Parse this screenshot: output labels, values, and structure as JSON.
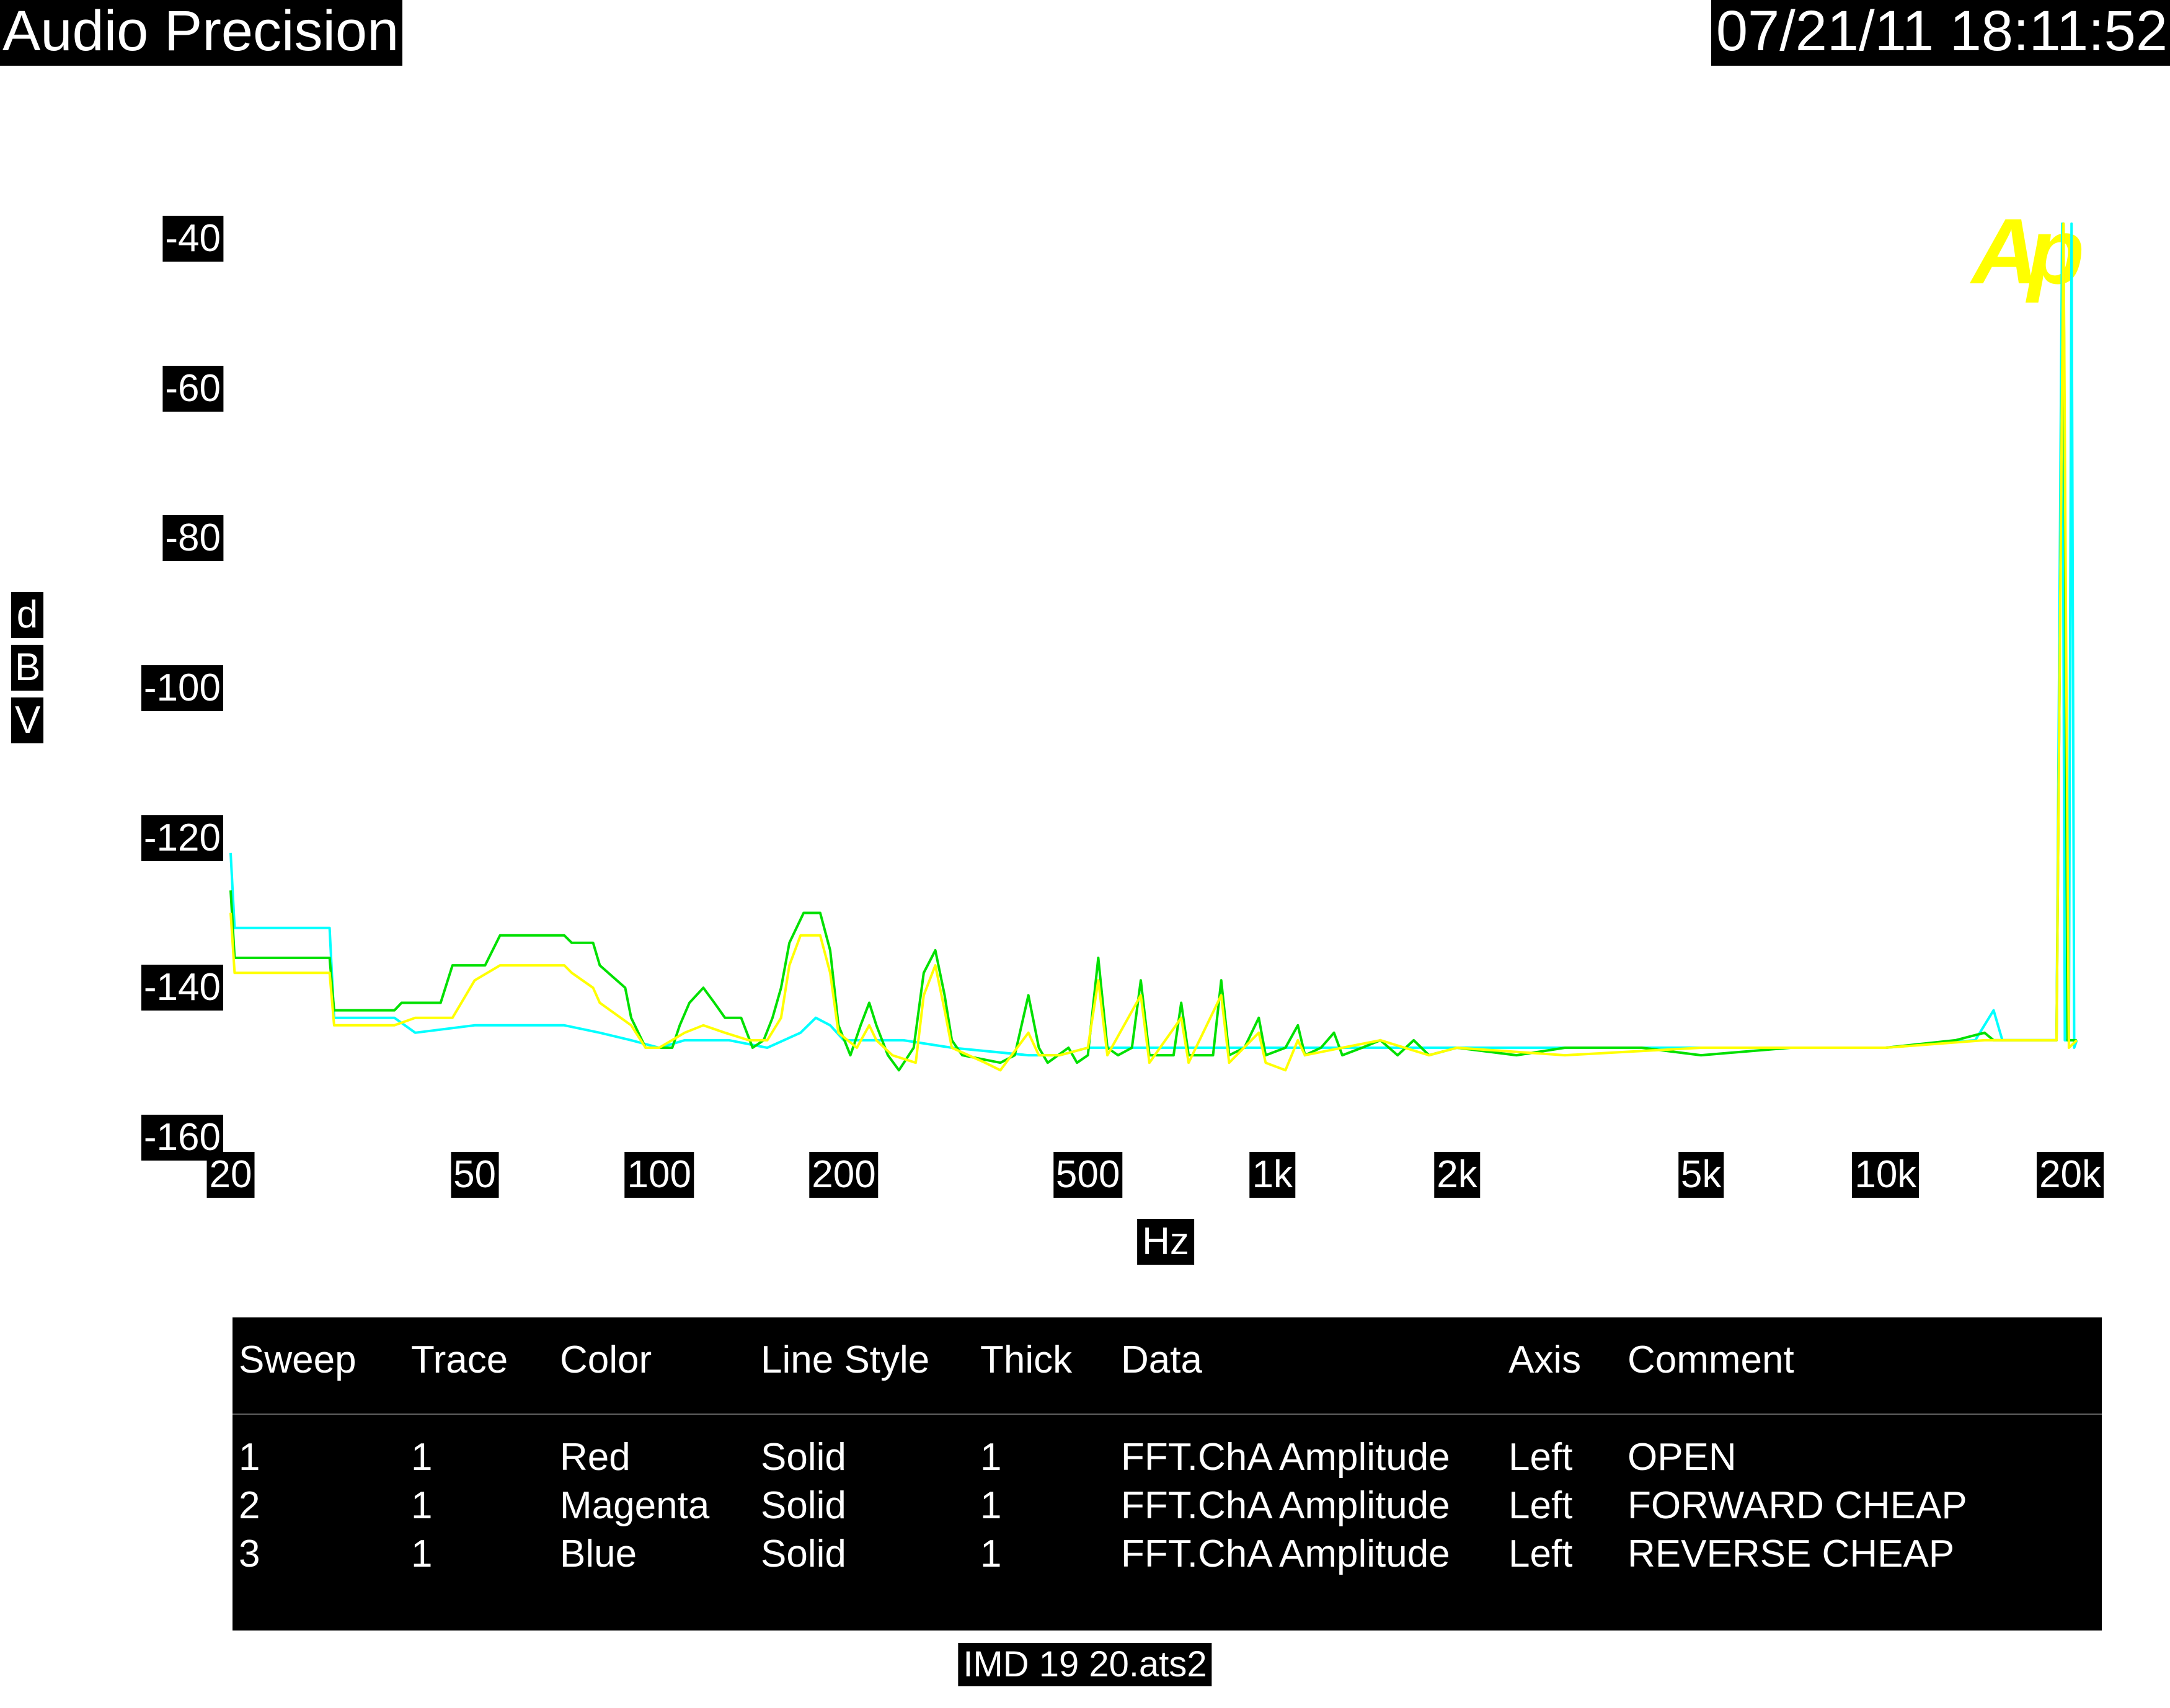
{
  "header": {
    "app_title": "Audio Precision",
    "timestamp": "07/21/11 18:11:52"
  },
  "logo_text": "Ap",
  "footer": {
    "file_name": "IMD 19 20.ats2"
  },
  "colors": {
    "background": "#ffffff",
    "label_bg": "#000000",
    "trace_open": "#00ffff",
    "trace_forward": "#00e000",
    "trace_reverse": "#ffff00",
    "logo": "#ffff00"
  },
  "legend": {
    "headers": [
      "Sweep",
      "Trace",
      "Color",
      "Line Style",
      "Thick",
      "Data",
      "Axis",
      "Comment"
    ],
    "rows": [
      [
        "1",
        "1",
        "Red",
        "Solid",
        "1",
        "FFT.ChA Amplitude",
        "Left",
        "OPEN"
      ],
      [
        "2",
        "1",
        "Magenta",
        "Solid",
        "1",
        "FFT.ChA Amplitude",
        "Left",
        "FORWARD CHEAP"
      ],
      [
        "3",
        "1",
        "Blue",
        "Solid",
        "1",
        "FFT.ChA Amplitude",
        "Left",
        "REVERSE CHEAP"
      ]
    ]
  },
  "chart_data": {
    "type": "line",
    "title": "",
    "xlabel": "Hz",
    "ylabel": "dBV",
    "ylabel_chars": [
      "d",
      "B",
      "V"
    ],
    "x_scale": "log",
    "xlim": [
      20,
      22000
    ],
    "ylim": [
      -160,
      -40
    ],
    "x_ticks": [
      {
        "value": 20,
        "label": "20"
      },
      {
        "value": 50,
        "label": "50"
      },
      {
        "value": 100,
        "label": "100"
      },
      {
        "value": 200,
        "label": "200"
      },
      {
        "value": 500,
        "label": "500"
      },
      {
        "value": 1000,
        "label": "1k"
      },
      {
        "value": 2000,
        "label": "2k"
      },
      {
        "value": 5000,
        "label": "5k"
      },
      {
        "value": 10000,
        "label": "10k"
      },
      {
        "value": 20000,
        "label": "20k"
      }
    ],
    "y_ticks": [
      {
        "value": -40,
        "label": "-40"
      },
      {
        "value": -60,
        "label": "-60"
      },
      {
        "value": -80,
        "label": "-80"
      },
      {
        "value": -100,
        "label": "-100"
      },
      {
        "value": -120,
        "label": "-120"
      },
      {
        "value": -140,
        "label": "-140"
      },
      {
        "value": -160,
        "label": "-160"
      }
    ],
    "grid": false,
    "legend_position": "bottom table",
    "series": [
      {
        "color": "#00ffff",
        "points": [
          [
            20,
            -122
          ],
          [
            20.3,
            -132
          ],
          [
            29,
            -132
          ],
          [
            29.5,
            -144
          ],
          [
            37,
            -144
          ],
          [
            40,
            -146
          ],
          [
            50,
            -145
          ],
          [
            60,
            -145
          ],
          [
            70,
            -145
          ],
          [
            80,
            -146
          ],
          [
            90,
            -147
          ],
          [
            100,
            -148
          ],
          [
            110,
            -147
          ],
          [
            130,
            -147
          ],
          [
            150,
            -148
          ],
          [
            170,
            -146
          ],
          [
            180,
            -144
          ],
          [
            190,
            -145
          ],
          [
            200,
            -147
          ],
          [
            250,
            -147
          ],
          [
            300,
            -148
          ],
          [
            400,
            -149
          ],
          [
            450,
            -149
          ],
          [
            500,
            -148
          ],
          [
            700,
            -148
          ],
          [
            1000,
            -148
          ],
          [
            1500,
            -148
          ],
          [
            2000,
            -148
          ],
          [
            3000,
            -148
          ],
          [
            4000,
            -148
          ],
          [
            5000,
            -148
          ],
          [
            7000,
            -148
          ],
          [
            10000,
            -148
          ],
          [
            14000,
            -147
          ],
          [
            15000,
            -143
          ],
          [
            15500,
            -147
          ],
          [
            17000,
            -147
          ],
          [
            19000,
            -147
          ],
          [
            19400,
            -38
          ],
          [
            19600,
            -147
          ],
          [
            19900,
            -147
          ],
          [
            20100,
            -38
          ],
          [
            20300,
            -148
          ],
          [
            20500,
            -147
          ]
        ]
      },
      {
        "color": "#00e000",
        "points": [
          [
            20,
            -127
          ],
          [
            20.3,
            -136
          ],
          [
            29,
            -136
          ],
          [
            29.5,
            -143
          ],
          [
            37,
            -143
          ],
          [
            38,
            -142
          ],
          [
            44,
            -142
          ],
          [
            46,
            -137
          ],
          [
            52,
            -137
          ],
          [
            55,
            -133
          ],
          [
            70,
            -133
          ],
          [
            72,
            -134
          ],
          [
            78,
            -134
          ],
          [
            80,
            -137
          ],
          [
            88,
            -140
          ],
          [
            90,
            -144
          ],
          [
            95,
            -148
          ],
          [
            100,
            -148
          ],
          [
            105,
            -148
          ],
          [
            108,
            -145
          ],
          [
            112,
            -142
          ],
          [
            118,
            -140
          ],
          [
            123,
            -142
          ],
          [
            128,
            -144
          ],
          [
            136,
            -144
          ],
          [
            142,
            -148
          ],
          [
            148,
            -147
          ],
          [
            153,
            -144
          ],
          [
            158,
            -140
          ],
          [
            163,
            -134
          ],
          [
            172,
            -130
          ],
          [
            183,
            -130
          ],
          [
            190,
            -135
          ],
          [
            196,
            -145
          ],
          [
            205,
            -149
          ],
          [
            213,
            -145
          ],
          [
            220,
            -142
          ],
          [
            226,
            -145
          ],
          [
            236,
            -149
          ],
          [
            246,
            -151
          ],
          [
            260,
            -148
          ],
          [
            270,
            -138
          ],
          [
            282,
            -135
          ],
          [
            292,
            -141
          ],
          [
            300,
            -147
          ],
          [
            312,
            -149
          ],
          [
            360,
            -150
          ],
          [
            380,
            -149
          ],
          [
            400,
            -141
          ],
          [
            416,
            -148
          ],
          [
            430,
            -150
          ],
          [
            465,
            -148
          ],
          [
            480,
            -150
          ],
          [
            500,
            -149
          ],
          [
            520,
            -136
          ],
          [
            538,
            -148
          ],
          [
            560,
            -149
          ],
          [
            590,
            -148
          ],
          [
            610,
            -139
          ],
          [
            630,
            -149
          ],
          [
            690,
            -149
          ],
          [
            710,
            -142
          ],
          [
            730,
            -149
          ],
          [
            800,
            -149
          ],
          [
            825,
            -139
          ],
          [
            850,
            -149
          ],
          [
            900,
            -148
          ],
          [
            950,
            -144
          ],
          [
            975,
            -149
          ],
          [
            1050,
            -148
          ],
          [
            1100,
            -145
          ],
          [
            1130,
            -149
          ],
          [
            1200,
            -148
          ],
          [
            1260,
            -146
          ],
          [
            1300,
            -149
          ],
          [
            1400,
            -148
          ],
          [
            1500,
            -147
          ],
          [
            1600,
            -149
          ],
          [
            1700,
            -147
          ],
          [
            1800,
            -149
          ],
          [
            2000,
            -148
          ],
          [
            2500,
            -149
          ],
          [
            3000,
            -148
          ],
          [
            4000,
            -148
          ],
          [
            5000,
            -149
          ],
          [
            7000,
            -148
          ],
          [
            10000,
            -148
          ],
          [
            13000,
            -147
          ],
          [
            14500,
            -146
          ],
          [
            15000,
            -147
          ],
          [
            17000,
            -147
          ],
          [
            19000,
            -147
          ],
          [
            19500,
            -38
          ],
          [
            19800,
            -147
          ],
          [
            20500,
            -147
          ]
        ]
      },
      {
        "color": "#ffff00",
        "points": [
          [
            20,
            -130
          ],
          [
            20.3,
            -138
          ],
          [
            29,
            -138
          ],
          [
            29.5,
            -145
          ],
          [
            37,
            -145
          ],
          [
            40,
            -144
          ],
          [
            46,
            -144
          ],
          [
            50,
            -139
          ],
          [
            55,
            -137
          ],
          [
            70,
            -137
          ],
          [
            72,
            -138
          ],
          [
            78,
            -140
          ],
          [
            80,
            -142
          ],
          [
            90,
            -145
          ],
          [
            95,
            -148
          ],
          [
            100,
            -148
          ],
          [
            110,
            -146
          ],
          [
            118,
            -145
          ],
          [
            128,
            -146
          ],
          [
            140,
            -147
          ],
          [
            150,
            -147
          ],
          [
            158,
            -144
          ],
          [
            163,
            -137
          ],
          [
            170,
            -133
          ],
          [
            183,
            -133
          ],
          [
            190,
            -138
          ],
          [
            196,
            -146
          ],
          [
            210,
            -148
          ],
          [
            220,
            -145
          ],
          [
            226,
            -147
          ],
          [
            240,
            -149
          ],
          [
            262,
            -150
          ],
          [
            270,
            -141
          ],
          [
            282,
            -137
          ],
          [
            292,
            -143
          ],
          [
            300,
            -148
          ],
          [
            340,
            -150
          ],
          [
            360,
            -151
          ],
          [
            400,
            -146
          ],
          [
            416,
            -149
          ],
          [
            450,
            -149
          ],
          [
            500,
            -148
          ],
          [
            520,
            -139
          ],
          [
            538,
            -149
          ],
          [
            610,
            -141
          ],
          [
            630,
            -150
          ],
          [
            710,
            -144
          ],
          [
            730,
            -150
          ],
          [
            825,
            -141
          ],
          [
            850,
            -150
          ],
          [
            950,
            -146
          ],
          [
            975,
            -150
          ],
          [
            1050,
            -151
          ],
          [
            1100,
            -147
          ],
          [
            1130,
            -149
          ],
          [
            1300,
            -148
          ],
          [
            1500,
            -147
          ],
          [
            1800,
            -149
          ],
          [
            2000,
            -148
          ],
          [
            3000,
            -149
          ],
          [
            5000,
            -148
          ],
          [
            10000,
            -148
          ],
          [
            14500,
            -147
          ],
          [
            17000,
            -147
          ],
          [
            19000,
            -147
          ],
          [
            19500,
            -38
          ],
          [
            19700,
            -96
          ],
          [
            19900,
            -148
          ],
          [
            20500,
            -147
          ]
        ]
      }
    ]
  }
}
